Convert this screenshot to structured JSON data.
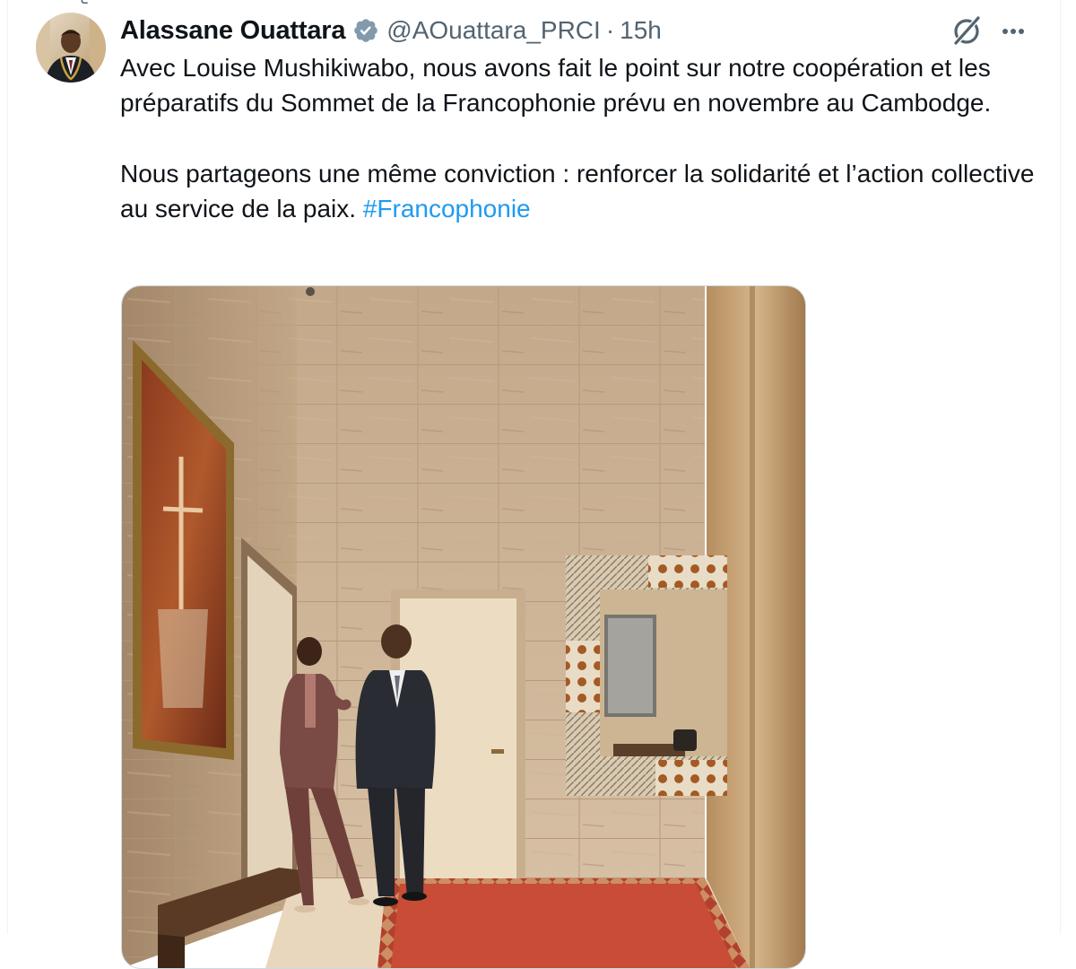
{
  "tweet": {
    "author_name": "Alassane Ouattara",
    "handle": "@AOuattara_PRCI",
    "separator": "·",
    "time": "15h",
    "text_paragraph_1": "Avec Louise Mushikiwabo, nous avons fait le point sur notre coopération et les préparatifs du Sommet de la Francophonie prévu en novembre au Cambodge.",
    "text_paragraph_2_prefix": "Nous partageons une même conviction : renforcer la solidarité et l’action collective au service de la paix. ",
    "hashtag": "#Francophonie"
  },
  "icons": {
    "verified": "verified-badge-icon",
    "grok": "grok-icon",
    "more": "more-options-icon",
    "social_context": "retweet-icon"
  },
  "colors": {
    "text_primary": "#0f1419",
    "text_secondary": "#536471",
    "link": "#1d9bf0",
    "border": "#cfd9de"
  }
}
